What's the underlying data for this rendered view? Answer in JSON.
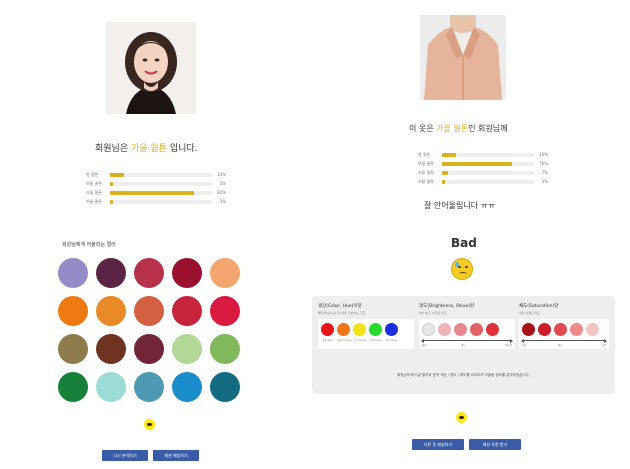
{
  "left": {
    "headline_prefix": "회원님은 ",
    "headline_accent": "가을 웜톤",
    "headline_suffix": " 입니다.",
    "stats": [
      {
        "label": "봄 웜톤",
        "percent": "14%",
        "value": 14
      },
      {
        "label": "여름 쿨톤",
        "percent": "3%",
        "value": 3
      },
      {
        "label": "가을 웜톤",
        "percent": "82%",
        "value": 82
      },
      {
        "label": "겨울 쿨톤",
        "percent": "3%",
        "value": 3
      }
    ],
    "palette_title": "회원님에게 어울리는 컬러",
    "palette": [
      "#948cc6",
      "#5b2444",
      "#b8314a",
      "#9b0f2f",
      "#f5a670",
      "#f07a12",
      "#ea8a26",
      "#d46042",
      "#c7233c",
      "#db1a43",
      "#8e7a4a",
      "#6f3321",
      "#702638",
      "#b3d796",
      "#80b85b",
      "#17803a",
      "#9cdcd6",
      "#4e9ab4",
      "#1b8ccc",
      "#126b80"
    ],
    "buttons": [
      "다시 분석하기",
      "패션 매칭하기"
    ]
  },
  "right": {
    "headline_prefix": "이 옷은 ",
    "headline_accent": "가을 웜톤",
    "headline_suffix": "인 회원님께",
    "stats": [
      {
        "label": "봄 웜톤",
        "percent": "15%",
        "value": 15
      },
      {
        "label": "여름 쿨톤",
        "percent": "76%",
        "value": 76
      },
      {
        "label": "가을 웜톤",
        "percent": "7%",
        "value": 7
      },
      {
        "label": "겨울 쿨톤",
        "percent": "3%",
        "value": 3
      }
    ],
    "verdict": "잘 안어울립니다 ㅠㅠ",
    "rating": "Bad",
    "analysis": {
      "hue_title": "색상(Color, Hue)이란",
      "hue_desc": "빨강/파랑/노랑 등 색을 구분하는 기준",
      "hue_dots": [
        "#e8141a",
        "#f07618",
        "#f2e21a",
        "#2bd82e",
        "#1a2ee0"
      ],
      "hue_labels": [
        "빨강 Red",
        "주황 Orange",
        "노랑 Yellow",
        "초록 Green",
        "파랑 Blue"
      ],
      "value_title": "명도(Brightness, Value)란",
      "value_desc": "색의 밝고 어두운 정도",
      "value_dots": [
        "#e6e6e6",
        "#eeb4b8",
        "#e88890",
        "#e26068",
        "#e0303a"
      ],
      "value_axis_left": "밝음",
      "value_axis_mid": "명도",
      "value_axis_right": "어두움",
      "sat_title": "채도(Saturation)란",
      "sat_desc": "색의 선명한 정도",
      "sat_dots": [
        "#a8101a",
        "#cc1c28",
        "#e44a50",
        "#ee8a8c",
        "#f2c4c4"
      ],
      "sat_axis_left": "높음",
      "sat_axis_mid": "채도",
      "sat_axis_right": "낮음",
      "note": "회원님의 퍼스널 컬러와 옷의 색상 / 명도 / 채도를 비교하여 어울림 정도를 분석하였습니다."
    },
    "buttons": [
      "다른 옷 매칭하기",
      "패션 추천 받기"
    ]
  }
}
